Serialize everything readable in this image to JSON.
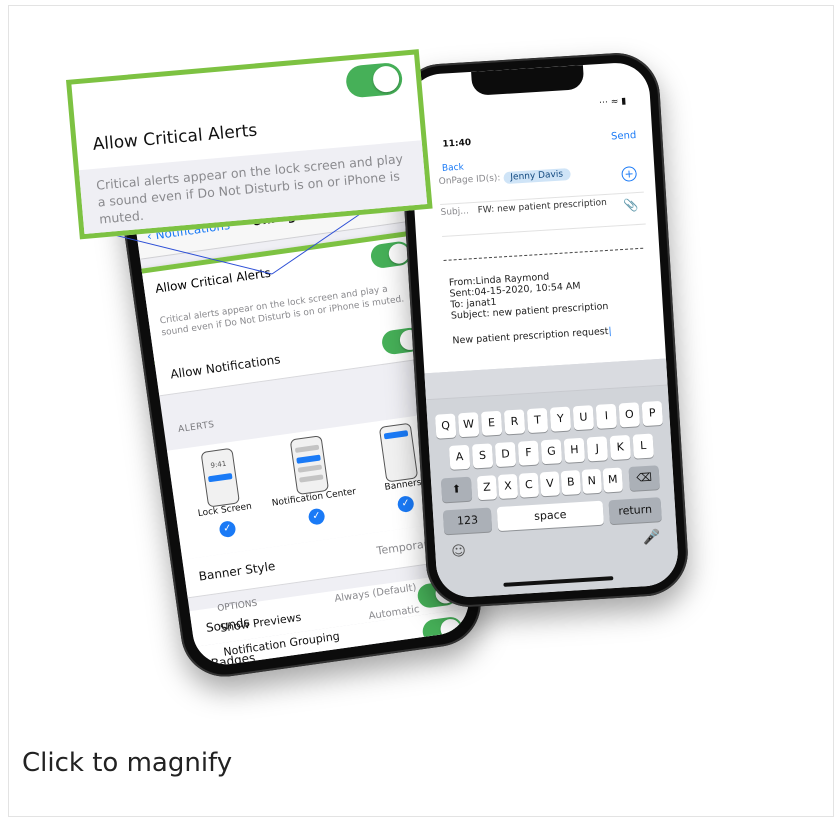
{
  "caption": "Click to magnify",
  "callout": {
    "title": "Allow Critical Alerts",
    "description": "Critical alerts appear on the lock screen and play a sound even if Do Not Disturb is on or iPhone is muted."
  },
  "settings": {
    "back_label": "Notifications",
    "nav_title": "OnPage",
    "critical_label": "Allow Critical Alerts",
    "critical_desc": "Critical alerts appear on the lock screen and play a sound even if Do Not Disturb is on or iPhone is muted.",
    "allow_notifications": "Allow Notifications",
    "alerts_header": "ALERTS",
    "alert_styles": [
      {
        "label": "Lock Screen",
        "preview_time": "9:41"
      },
      {
        "label": "Notification Center"
      },
      {
        "label": "Banners"
      }
    ],
    "banner_style_label": "Banner Style",
    "banner_style_value": "Temporary",
    "sounds_label": "Sounds",
    "badges_label": "Badges",
    "options_header": "OPTIONS",
    "show_previews_label": "Show Previews",
    "show_previews_value": "Always (Default)",
    "grouping_label": "Notification Grouping",
    "grouping_value": "Automatic"
  },
  "compose": {
    "time": "11:40",
    "send_label": "Send",
    "back_label": "Back",
    "to_label": "OnPage ID(s):",
    "recipient": "Jenny Davis",
    "subject_label": "Subj...",
    "subject": "FW: new patient prescription",
    "body_lines": [
      "From:Linda Raymond",
      "Sent:04-15-2020, 10:54 AM",
      "To: janat1",
      "Subject: new patient prescription"
    ],
    "body_request": "New patient prescription request"
  },
  "keyboard": {
    "row1": [
      "Q",
      "W",
      "E",
      "R",
      "T",
      "Y",
      "U",
      "I",
      "O",
      "P"
    ],
    "row2": [
      "A",
      "S",
      "D",
      "F",
      "G",
      "H",
      "J",
      "K",
      "L"
    ],
    "row3": [
      "Z",
      "X",
      "C",
      "V",
      "B",
      "N",
      "M"
    ],
    "numbers": "123",
    "space": "space",
    "return": "return"
  },
  "icons": {
    "shift": "shift-icon",
    "delete": "delete-icon",
    "emoji": "emoji-icon",
    "mic": "microphone-icon"
  },
  "colors": {
    "highlight": "#7dc242",
    "toggle_on": "#46b058",
    "ios_blue": "#1a7af6"
  }
}
